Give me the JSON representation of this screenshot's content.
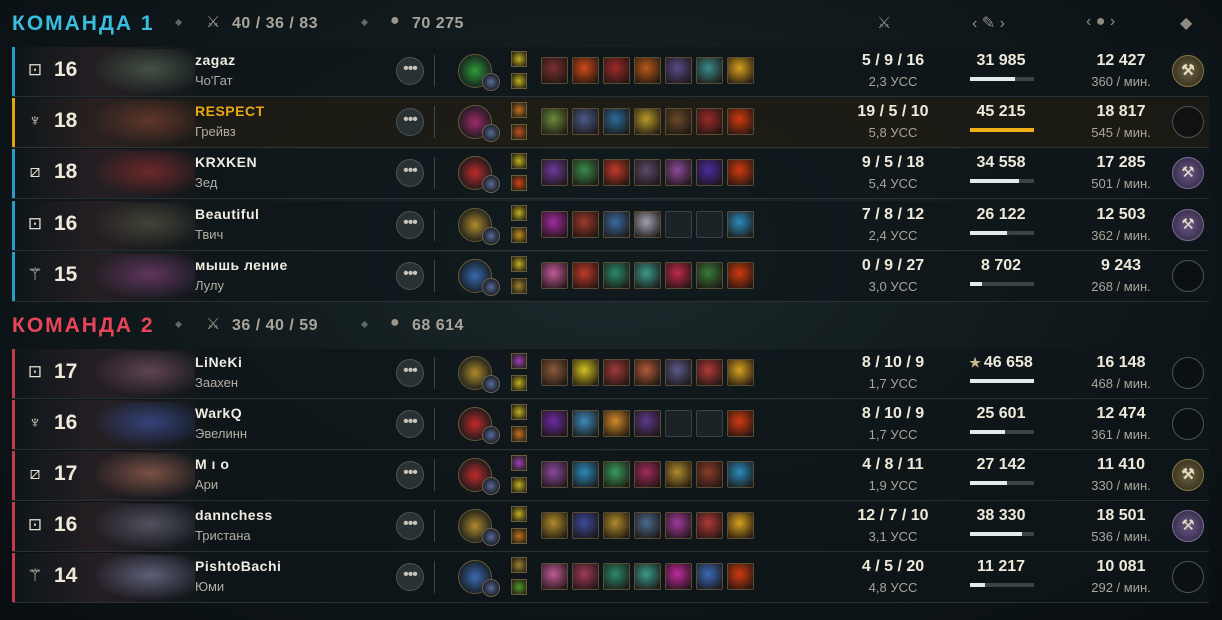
{
  "team1": {
    "title": "КОМАНДА 1",
    "kda": "40 / 36 / 83",
    "gold": "70 275",
    "color": "#3bbde0"
  },
  "team2": {
    "title": "КОМАНДА 2",
    "kda": "36 / 40 / 59",
    "gold": "68 614",
    "color": "#e8455a"
  },
  "column_icons": [
    "kda-swords-icon",
    "damage-sword-icon",
    "gold-coins-icon",
    "badge-diamond-icon"
  ],
  "players": [
    {
      "team": 1,
      "level": "16",
      "name": "zagaz",
      "champion": "Чо'Гат",
      "role_icon": "top-role-icon",
      "kda": "5 / 9 / 16",
      "cs": "2,3 УСС",
      "damage": "31 985",
      "damage_share": 0.71,
      "gold": "12 427",
      "gpm": "360 / мин.",
      "badge": "gold",
      "face": "#4a5a4a",
      "keystone": "#2f9a3a",
      "items": [
        "#7a3030",
        "#d04a1a",
        "#a02a2a",
        "#b85a1a",
        "#5a4a8a",
        "#3a8a8a",
        "#d8a020"
      ],
      "spells": [
        "#c0b020",
        "#c0b020"
      ]
    },
    {
      "team": 1,
      "level": "18",
      "name": "RESPECT",
      "champion": "Грейвз",
      "role_icon": "jungle-role-icon",
      "kda": "19 / 5 / 10",
      "cs": "5,8 УСС",
      "damage": "45 215",
      "damage_share": 1.0,
      "gold": "18 817",
      "gpm": "545 / мин.",
      "badge": "none",
      "highlight": true,
      "face": "#6a3a2a",
      "keystone": "#a02a6a",
      "items": [
        "#6a8a3a",
        "#4a5a8a",
        "#2a6a9a",
        "#b89a2a",
        "#6a4a2a",
        "#9a2a2a",
        "#d03a10"
      ],
      "spells": [
        "#c07020",
        "#c05020"
      ]
    },
    {
      "team": 1,
      "level": "18",
      "name": "KRXKEN",
      "champion": "Зед",
      "role_icon": "mid-role-icon",
      "kda": "9 / 5 / 18",
      "cs": "5,4 УСС",
      "damage": "34 558",
      "damage_share": 0.76,
      "gold": "17 285",
      "gpm": "501 / мин.",
      "badge": "purple",
      "face": "#7a2a2a",
      "keystone": "#c02a2a",
      "items": [
        "#6a3a9a",
        "#3a8a4a",
        "#c03a2a",
        "#5a4a6a",
        "#8a4a9a",
        "#4a2aa0",
        "#d03a10"
      ],
      "spells": [
        "#c0b020",
        "#d04010"
      ]
    },
    {
      "team": 1,
      "level": "16",
      "name": "Beautiful",
      "champion": "Твич",
      "role_icon": "bot-role-icon",
      "kda": "7 / 8 / 12",
      "cs": "2,4 УСС",
      "damage": "26 122",
      "damage_share": 0.58,
      "gold": "12 503",
      "gpm": "362 / мин.",
      "badge": "purple",
      "face": "#4a4a3a",
      "keystone": "#b08a2a",
      "items": [
        "#a02aa0",
        "#9a3a2a",
        "#3a6aa0",
        "#a0a0b0",
        "empty",
        "empty",
        "#2a8aba"
      ],
      "spells": [
        "#c0b020",
        "#c09020"
      ]
    },
    {
      "team": 1,
      "level": "15",
      "name": "мышь ление",
      "champion": "Лулу",
      "role_icon": "support-role-icon",
      "kda": "0 / 9 / 27",
      "cs": "3,0 УСС",
      "damage": "8 702",
      "damage_share": 0.19,
      "gold": "9 243",
      "gpm": "268 / мин.",
      "badge": "none",
      "face": "#6a3a6a",
      "keystone": "#3a6ab0",
      "items": [
        "#c05a9a",
        "#c03a2a",
        "#2a8a6a",
        "#3a9a8a",
        "#c02a4a",
        "#3a7a3a",
        "#d03a10"
      ],
      "spells": [
        "#c0b020",
        "#a08030"
      ]
    },
    {
      "team": 2,
      "level": "17",
      "name": "LiNeKi",
      "champion": "Заахен",
      "role_icon": "top-role-icon",
      "kda": "8 / 10 / 9",
      "cs": "1,7 УСС",
      "damage": "46 658",
      "damage_share": 1.0,
      "star": "★",
      "gold": "16 148",
      "gpm": "468 / мин.",
      "badge": "none",
      "face": "#6a4a5a",
      "keystone": "#b08a2a",
      "items": [
        "#8a5a3a",
        "#d0c020",
        "#a03a3a",
        "#b05a3a",
        "#5a5a8a",
        "#b03a3a",
        "#d8a020"
      ],
      "spells": [
        "#9a3ac0",
        "#c0b020"
      ]
    },
    {
      "team": 2,
      "level": "16",
      "name": "WarkQ",
      "champion": "Эвелинн",
      "role_icon": "jungle-role-icon",
      "kda": "8 / 10 / 9",
      "cs": "1,7 УСС",
      "damage": "25 601",
      "damage_share": 0.55,
      "gold": "12 474",
      "gpm": "361 / мин.",
      "badge": "none",
      "face": "#3a4a8a",
      "keystone": "#c02a2a",
      "items": [
        "#6a2aa0",
        "#3a8aba",
        "#d08a2a",
        "#5a3a8a",
        "empty",
        "empty",
        "#d03a10"
      ],
      "spells": [
        "#c0b020",
        "#c07020"
      ]
    },
    {
      "team": 2,
      "level": "17",
      "name": "M ı o",
      "champion": "Ари",
      "role_icon": "mid-role-icon",
      "kda": "4 / 8 / 11",
      "cs": "1,9 УСС",
      "damage": "27 142",
      "damage_share": 0.58,
      "gold": "11 410",
      "gpm": "330 / мин.",
      "badge": "gold",
      "face": "#8a5a4a",
      "keystone": "#c02a2a",
      "items": [
        "#8a4aa0",
        "#2a8aba",
        "#3a9a5a",
        "#a02a5a",
        "#b08a2a",
        "#8a3a2a",
        "#2a8aba"
      ],
      "spells": [
        "#9a3ac0",
        "#c0b020"
      ]
    },
    {
      "team": 2,
      "level": "16",
      "name": "dannchess",
      "champion": "Тристана",
      "role_icon": "bot-role-icon",
      "kda": "12 / 7 / 10",
      "cs": "3,1 УСС",
      "damage": "38 330",
      "damage_share": 0.82,
      "gold": "18 501",
      "gpm": "536 / мин.",
      "badge": "purple",
      "face": "#5a5a6a",
      "keystone": "#b08a2a",
      "items": [
        "#b08a2a",
        "#3a4a9a",
        "#b08a2a",
        "#4a6a8a",
        "#a03a9a",
        "#b03a3a",
        "#d8a020"
      ],
      "spells": [
        "#c0b020",
        "#c07020"
      ]
    },
    {
      "team": 2,
      "level": "14",
      "name": "PishtoBachi",
      "champion": "Юми",
      "role_icon": "support-role-icon",
      "kda": "4 / 5 / 20",
      "cs": "4,8 УСС",
      "damage": "11 217",
      "damage_share": 0.24,
      "gold": "10 081",
      "gpm": "292 / мин.",
      "badge": "none",
      "face": "#6a6a8a",
      "keystone": "#3a6ab0",
      "items": [
        "#c05a9a",
        "#a03a5a",
        "#2a8a6a",
        "#3a9a8a",
        "#c02aa0",
        "#3a6aba",
        "#d03a10"
      ],
      "spells": [
        "#a08030",
        "#4a9a2a"
      ]
    }
  ]
}
